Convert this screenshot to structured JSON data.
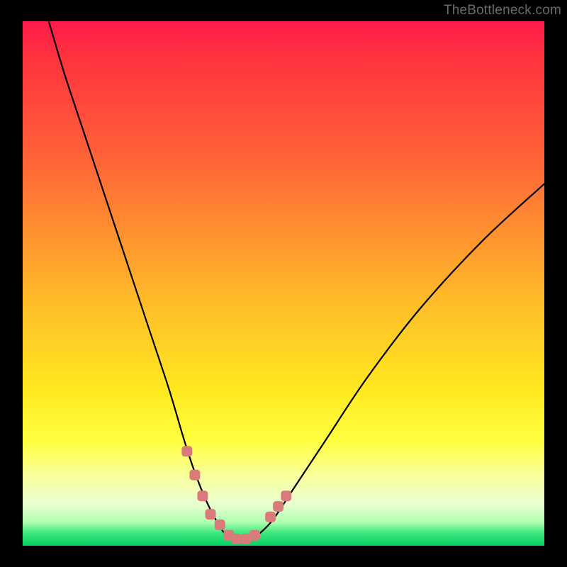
{
  "watermark": "TheBottleneck.com",
  "colors": {
    "frame": "#000000",
    "curve": "#000000",
    "marker": "#d97b7b",
    "gradient_top": "#ff1a4a",
    "gradient_bottom": "#00d060"
  },
  "chart_data": {
    "type": "line",
    "title": "",
    "xlabel": "",
    "ylabel": "",
    "xlim": [
      0,
      100
    ],
    "ylim": [
      0,
      100
    ],
    "series": [
      {
        "name": "bottleneck-curve",
        "x": [
          5,
          8,
          12,
          16,
          20,
          24,
          28,
          31,
          33,
          35,
          37,
          39,
          41,
          43,
          45,
          48,
          52,
          58,
          66,
          76,
          88,
          100
        ],
        "values": [
          100,
          90,
          78,
          66,
          54,
          42,
          30,
          20,
          14,
          9,
          5,
          2,
          1,
          1,
          2,
          5,
          11,
          20,
          32,
          45,
          58,
          69
        ]
      }
    ],
    "markers": {
      "name": "highlighted-region",
      "x": [
        31.5,
        33.0,
        34.5,
        36.0,
        37.8,
        39.5,
        41.0,
        42.8,
        44.5,
        47.5,
        49.0,
        50.5
      ],
      "values": [
        18.0,
        13.5,
        9.5,
        6.0,
        4.0,
        2.0,
        1.3,
        1.3,
        2.0,
        5.5,
        7.5,
        9.5
      ]
    }
  }
}
